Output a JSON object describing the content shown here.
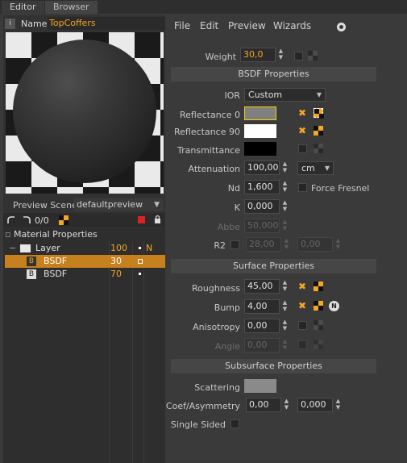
{
  "tabs": [
    "Editor",
    "Browser"
  ],
  "name_label": "Name",
  "name_value": "TopCoffers",
  "preview": {
    "scene_label": "Preview Scene",
    "scene_value": "defaultpreview"
  },
  "toolbar": {
    "count": "0/0"
  },
  "tree": {
    "header": "Material Properties",
    "rows": [
      {
        "label": "Layer",
        "value": "100",
        "extra": "N"
      },
      {
        "label": "BSDF",
        "value": "30",
        "selected": true
      },
      {
        "label": "BSDF",
        "value": "70"
      }
    ]
  },
  "menu": [
    "File",
    "Edit",
    "Preview",
    "Wizards"
  ],
  "weight": {
    "label": "Weight",
    "value": "30,0"
  },
  "sections": {
    "bsdf": "BSDF Properties",
    "surface": "Surface Properties",
    "subsurface": "Subsurface Properties"
  },
  "ior": {
    "label": "IOR",
    "value": "Custom"
  },
  "reflectance0": {
    "label": "Reflectance 0",
    "color": "#808080"
  },
  "reflectance90": {
    "label": "Reflectance 90",
    "color": "#ffffff"
  },
  "transmittance": {
    "label": "Transmittance",
    "color": "#000000"
  },
  "attenuation": {
    "label": "Attenuation",
    "value": "100,00",
    "unit": "cm"
  },
  "nd": {
    "label": "Nd",
    "value": "1,600",
    "force_fresnel": "Force Fresnel"
  },
  "k": {
    "label": "K",
    "value": "0,000"
  },
  "abbe": {
    "label": "Abbe",
    "value": "50,000"
  },
  "r2": {
    "label": "R2",
    "value1": "28,00",
    "value2": "0,00"
  },
  "roughness": {
    "label": "Roughness",
    "value": "45,00"
  },
  "bump": {
    "label": "Bump",
    "value": "4,00",
    "n_badge": "N"
  },
  "anisotropy": {
    "label": "Anisotropy",
    "value": "0,00"
  },
  "angle": {
    "label": "Angle",
    "value": "0,00"
  },
  "scattering": {
    "label": "Scattering",
    "color": "#8a8a8a"
  },
  "coef": {
    "label": "Coef/Asymmetry",
    "value1": "0,00",
    "value2": "0,000"
  },
  "single_sided": {
    "label": "Single Sided"
  },
  "colors": {
    "accent": "#f5a623",
    "selection": "#c7801e",
    "panel": "#3a3a3a"
  }
}
